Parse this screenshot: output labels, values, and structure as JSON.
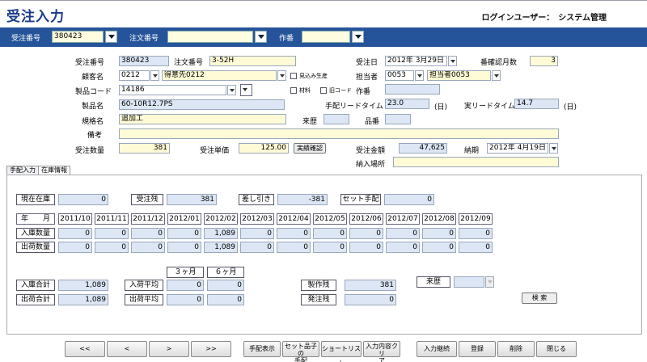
{
  "header": {
    "title": "受注入力",
    "login": "ログインユーザー：　システム管理"
  },
  "searchbar": {
    "order_no_label": "受注番号",
    "order_no_value": "380423",
    "po_no_label": "注文番号",
    "po_no_value": "",
    "work_no_label": "作番",
    "work_no_value": ""
  },
  "form": {
    "order_no_label": "受注番号",
    "order_no": "380423",
    "po_no_label": "注文番号",
    "po_no": "3-52H",
    "order_date_label": "受注日",
    "order_date": "2012年 3月29日",
    "confirm_months_label": "番確認月数",
    "confirm_months": "3",
    "customer_label": "顧客名",
    "customer_code": "0212",
    "customer_name": "得意先0212",
    "forecast_label": "見込み生産",
    "staff_label": "担当者",
    "staff_code": "0053",
    "staff_name": "担当者0053",
    "product_code_label": "製品コード",
    "product_code": "14186",
    "material_label": "材料",
    "old_code_label": "旧コード",
    "work_no_label": "作番",
    "work_no": "",
    "product_name_label": "製品名",
    "product_name": "60-10R12.7PS",
    "lead_time_label": "手配リードタイム",
    "lead_time": "23.0",
    "lead_time_unit": "(日)",
    "actual_lead_label": "実リードタイム",
    "actual_lead": "14.7",
    "actual_lead_unit": "(日)",
    "spec_label": "規格名",
    "spec": "追加工",
    "history_label": "来歴",
    "history": "",
    "item_no_label": "品番",
    "item_no": "",
    "notes_label": "備考",
    "notes": "",
    "qty_label": "受注数量",
    "qty": "381",
    "price_label": "受注単価",
    "price": "125.00",
    "confirm_btn": "実績確認",
    "amount_label": "受注金額",
    "amount": "47,625",
    "delivery_label": "納期",
    "delivery_date": "2012年 4月19日",
    "delivery_place_label": "納入場所",
    "delivery_place": ""
  },
  "tabs": [
    {
      "label": "手配入力"
    },
    {
      "label": "在庫情報"
    }
  ],
  "stock": {
    "current_label": "現在在庫",
    "current": "0",
    "remaining_label": "受注残",
    "remaining": "381",
    "diff_label": "差し引き",
    "diff": "-381",
    "set_label": "セット手配",
    "set": "0",
    "month_header": "年　　月",
    "months": [
      "2011/10",
      "2011/11",
      "2011/12",
      "2012/01",
      "2012/02",
      "2012/03",
      "2012/04",
      "2012/05",
      "2012/06",
      "2012/07",
      "2012/08",
      "2012/09"
    ],
    "in_label": "入庫数量",
    "in_values": [
      "0",
      "0",
      "0",
      "0",
      "1,089",
      "0",
      "0",
      "0",
      "0",
      "0",
      "0",
      "0"
    ],
    "out_label": "出荷数量",
    "out_values": [
      "0",
      "0",
      "0",
      "0",
      "1,089",
      "0",
      "0",
      "0",
      "0",
      "0",
      "0",
      "0"
    ],
    "three_month": "３ヶ月",
    "six_month": "６ヶ月",
    "in_total_label": "入庫合計",
    "in_total": "1,089",
    "out_total_label": "出荷合計",
    "out_total": "1,089",
    "in_avg_label": "入荷平均",
    "in_avg_3": "0",
    "in_avg_6": "0",
    "out_avg_label": "出荷平均",
    "out_avg_3": "0",
    "out_avg_6": "0",
    "production_label": "製作残",
    "production": "381",
    "order_remain_label": "発注残",
    "order_remain": "0",
    "history_label": "来歴",
    "history": "",
    "search_btn": "検 索"
  },
  "bottom": {
    "first": "<<",
    "prev": "<",
    "next": ">",
    "last": ">>",
    "arrange_view": "手配表示",
    "set_child_1": "セット品子の",
    "set_child_2": "手配",
    "shortlist": "ショートリスト",
    "clear_1": "入力内容クリ",
    "clear_2": "ア",
    "continue": "入力継続",
    "register": "登録",
    "delete": "削除",
    "close": "閉じる"
  }
}
